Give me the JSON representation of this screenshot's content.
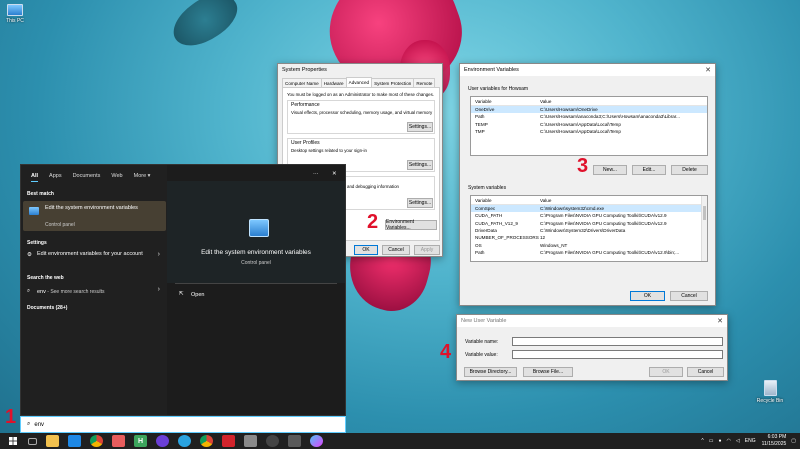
{
  "desktop": {
    "this_pc_label": "This PC",
    "recycle_bin_label": "Recycle Bin"
  },
  "annotations": [
    "1",
    "2",
    "3",
    "4"
  ],
  "system_properties": {
    "title": "System Properties",
    "tabs": [
      "Computer Name",
      "Hardware",
      "Advanced",
      "System Protection",
      "Remote"
    ],
    "active_tab": "Advanced",
    "admin_note": "You must be logged on as an Administrator to make most of these changes.",
    "performance_heading": "Performance",
    "performance_desc": "Visual effects, processor scheduling, memory usage, and virtual memory",
    "user_profiles_heading": "User Profiles",
    "user_profiles_desc": "Desktop settings related to your sign-in",
    "startup_desc": "and debugging information",
    "settings_label": "Settings...",
    "env_button": "Environment Variables...",
    "ok": "OK",
    "cancel": "Cancel",
    "apply": "Apply"
  },
  "env_vars": {
    "title": "Environment Variables",
    "user_heading": "User variables for Howsam",
    "col_variable": "Variable",
    "col_value": "Value",
    "user_rows": [
      {
        "name": "OneDrive",
        "value": "C:\\Users\\Howsam\\OneDrive"
      },
      {
        "name": "Path",
        "value": "C:\\Users\\Howsam\\anaconda3;C:\\Users\\Howsam\\anaconda3\\Librar..."
      },
      {
        "name": "TEMP",
        "value": "C:\\Users\\Howsam\\AppData\\Local\\Temp"
      },
      {
        "name": "TMP",
        "value": "C:\\Users\\Howsam\\AppData\\Local\\Temp"
      }
    ],
    "system_heading": "System variables",
    "system_rows": [
      {
        "name": "ComSpec",
        "value": "C:\\Windows\\system32\\cmd.exe"
      },
      {
        "name": "CUDA_PATH",
        "value": "C:\\Program Files\\NVIDIA GPU Computing Toolkit\\CUDA\\v12.9"
      },
      {
        "name": "CUDA_PATH_V12_9",
        "value": "C:\\Program Files\\NVIDIA GPU Computing Toolkit\\CUDA\\v12.9"
      },
      {
        "name": "DriverData",
        "value": "C:\\Windows\\System32\\Drivers\\DriverData"
      },
      {
        "name": "NUMBER_OF_PROCESSORS",
        "value": "12"
      },
      {
        "name": "OS",
        "value": "Windows_NT"
      },
      {
        "name": "Path",
        "value": "C:\\Program Files\\NVIDIA GPU Computing Toolkit\\CUDA\\v12.9\\bin;..."
      }
    ],
    "new": "New...",
    "edit": "Edit...",
    "delete": "Delete",
    "ok": "OK",
    "cancel": "Cancel"
  },
  "new_user_var": {
    "title": "New User Variable",
    "name_label": "Variable name:",
    "value_label": "Variable value:",
    "browse_dir": "Browse Directory...",
    "browse_file": "Browse File...",
    "ok": "OK",
    "cancel": "Cancel"
  },
  "start_menu": {
    "tabs": [
      "All",
      "Apps",
      "Documents",
      "Web",
      "More ▾"
    ],
    "best_match_heading": "Best match",
    "best_match_title": "Edit the system environment variables",
    "best_match_sub": "Control panel",
    "settings_heading": "Settings",
    "settings_item": "Edit environment variables for your account",
    "web_heading": "Search the web",
    "web_item_query": "env",
    "web_item_suffix": " - See more search results",
    "documents_heading": "Documents (28+)",
    "preview_title": "Edit the system environment variables",
    "preview_sub": "Control panel",
    "open_label": "Open",
    "more_dots": "···",
    "close": "✕"
  },
  "search": {
    "query": "env"
  },
  "taskbar": {
    "apps": [
      "file-explorer",
      "vscode",
      "chrome",
      "notepad",
      "h-app",
      "obs",
      "telegram",
      "chrome-profile",
      "acrobat",
      "media",
      "github",
      "settings",
      "copilot"
    ],
    "language": "ENG",
    "time": "6:03 PM",
    "date": "11/15/2025"
  }
}
